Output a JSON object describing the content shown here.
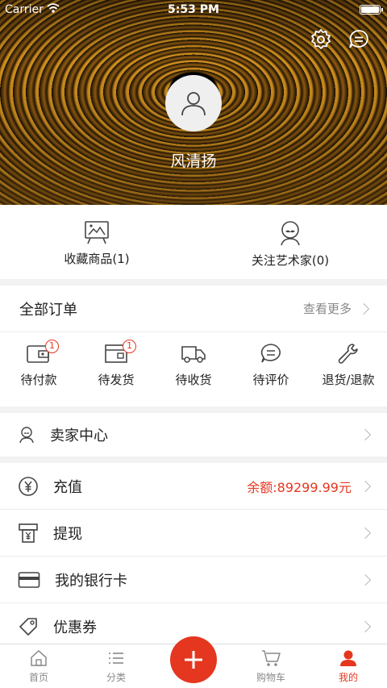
{
  "status_bar": {
    "carrier": "Carrier",
    "time": "5:53 PM"
  },
  "profile": {
    "username": "风清扬"
  },
  "favorites": [
    {
      "label": "收藏商品(1)",
      "icon": "easel-icon"
    },
    {
      "label": "关注艺术家(0)",
      "icon": "artist-icon"
    }
  ],
  "orders": {
    "title": "全部订单",
    "more": "查看更多",
    "items": [
      {
        "label": "待付款",
        "badge": "1"
      },
      {
        "label": "待发货",
        "badge": "1"
      },
      {
        "label": "待收货",
        "badge": ""
      },
      {
        "label": "待评价",
        "badge": ""
      },
      {
        "label": "退货/退款",
        "badge": ""
      }
    ]
  },
  "seller": {
    "label": "卖家中心"
  },
  "menu": [
    {
      "label": "充值",
      "value": "余额:89299.99元"
    },
    {
      "label": "提现",
      "value": ""
    },
    {
      "label": "我的银行卡",
      "value": ""
    },
    {
      "label": "优惠券",
      "value": ""
    }
  ],
  "tabs": [
    {
      "label": "首页"
    },
    {
      "label": "分类"
    },
    {
      "label": ""
    },
    {
      "label": "购物车"
    },
    {
      "label": "我的"
    }
  ],
  "colors": {
    "accent": "#e5361f",
    "text": "#222222",
    "muted": "#888888"
  }
}
